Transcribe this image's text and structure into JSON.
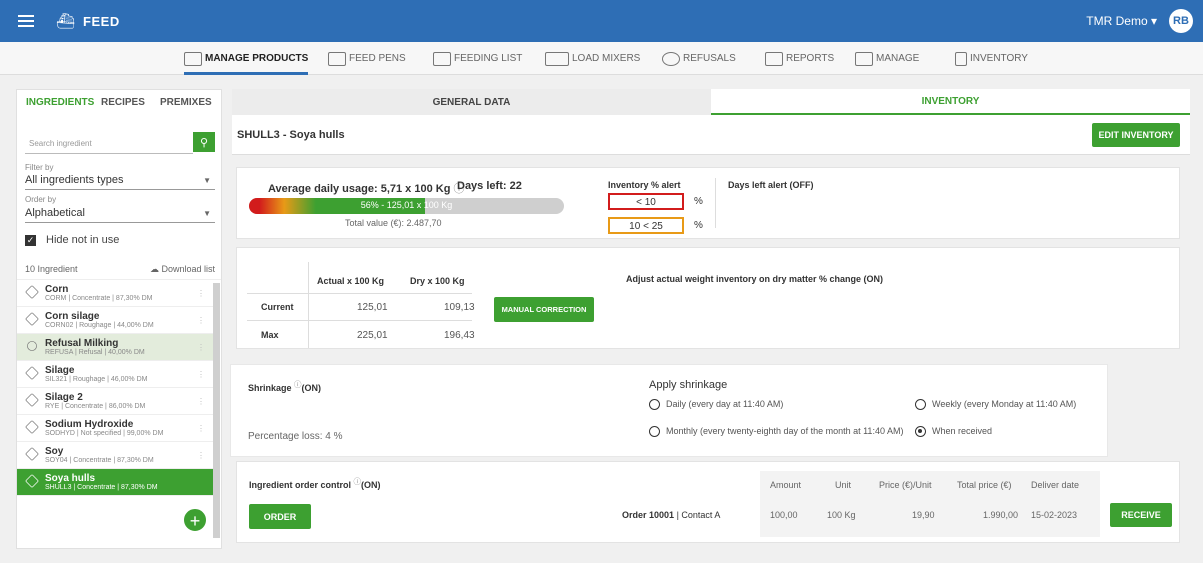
{
  "topbar": {
    "title": "FEED",
    "user": "TMR Demo",
    "user_caret": "▾",
    "avatar": "RB"
  },
  "nav": [
    {
      "label": "MANAGE PRODUCTS",
      "active": true
    },
    {
      "label": "FEED PENS"
    },
    {
      "label": "FEEDING LIST"
    },
    {
      "label": "LOAD MIXERS"
    },
    {
      "label": "REFUSALS"
    },
    {
      "label": "REPORTS"
    },
    {
      "label": "MANAGE"
    },
    {
      "label": "INVENTORY"
    }
  ],
  "sidebar": {
    "tabs": [
      "INGREDIENTS",
      "RECIPES",
      "PREMIXES"
    ],
    "search_placeholder": "Search ingredient",
    "filter_label": "Filter by",
    "filter_value": "All ingredients types",
    "order_label": "Order by",
    "order_value": "Alphabetical",
    "hide_label": "Hide not in use",
    "count": "10 Ingredient",
    "download": "Download list",
    "items": [
      {
        "name": "Corn",
        "sub": "CORM | Concentrate | 87,30% DM"
      },
      {
        "name": "Corn silage",
        "sub": "CORN02 | Roughage | 44,00% DM"
      },
      {
        "name": "Refusal Milking",
        "sub": "REFUSA | Refusal | 40,00% DM"
      },
      {
        "name": "Silage",
        "sub": "SIL321 | Roughage | 46,00% DM"
      },
      {
        "name": "Silage 2",
        "sub": "RYE | Concentrate | 86,00% DM"
      },
      {
        "name": "Sodium Hydroxide",
        "sub": "SODHYD | Not specified | 99,00% DM"
      },
      {
        "name": "Soy",
        "sub": "SOY04 | Concentrate | 87,30% DM"
      },
      {
        "name": "Soya hulls",
        "sub": "SHULL3 | Concentrate | 87,30% DM"
      }
    ]
  },
  "main": {
    "tab_general": "GENERAL DATA",
    "tab_inventory": "INVENTORY",
    "header_title": "SHULL3 - Soya hulls",
    "edit_button": "EDIT INVENTORY",
    "avg_usage": "Average daily usage: 5,71 x 100 Kg",
    "days_left": "Days left: 22",
    "bar_text": "56% - 125,01 x 100 Kg",
    "bar_fill": 56,
    "total_value": "Total value (€): 2.487,70",
    "alert_title": "Inventory % alert",
    "alert_red": "< 10",
    "alert_orange": "10 < 25",
    "pct": "%",
    "days_alert": "Days left alert (OFF)",
    "table": {
      "col_actual": "Actual x 100 Kg",
      "col_dry": "Dry x 100 Kg",
      "rows": [
        {
          "label": "Current",
          "actual": "125,01",
          "dry": "109,13"
        },
        {
          "label": "Max",
          "actual": "225,01",
          "dry": "196,43"
        }
      ]
    },
    "manual_button": "MANUAL CORRECTION",
    "adjust_text": "Adjust actual weight inventory on dry matter % change (ON)",
    "shrinkage_title": "Shrinkage",
    "shrinkage_state": "(ON)",
    "percentage_loss": "Percentage loss: 4 %",
    "apply_shrinkage": "Apply shrinkage",
    "opt_daily": "Daily (every day at 11:40 AM)",
    "opt_weekly": "Weekly (every Monday at 11:40 AM)",
    "opt_monthly": "Monthly (every twenty-eighth day of the month at 11:40 AM)",
    "opt_received": "When received",
    "order_control": "Ingredient order control",
    "order_state": "(ON)",
    "order_button": "ORDER",
    "order_cols": [
      "Amount",
      "Unit",
      "Price (€)/Unit",
      "Total price (€)",
      "Deliver date"
    ],
    "order_label_bold": "Order 10001",
    "order_contact": "| Contact A",
    "order_values": [
      "100,00",
      "100 Kg",
      "19,90",
      "1.990,00",
      "15-02-2023"
    ],
    "receive_button": "RECEIVE"
  }
}
